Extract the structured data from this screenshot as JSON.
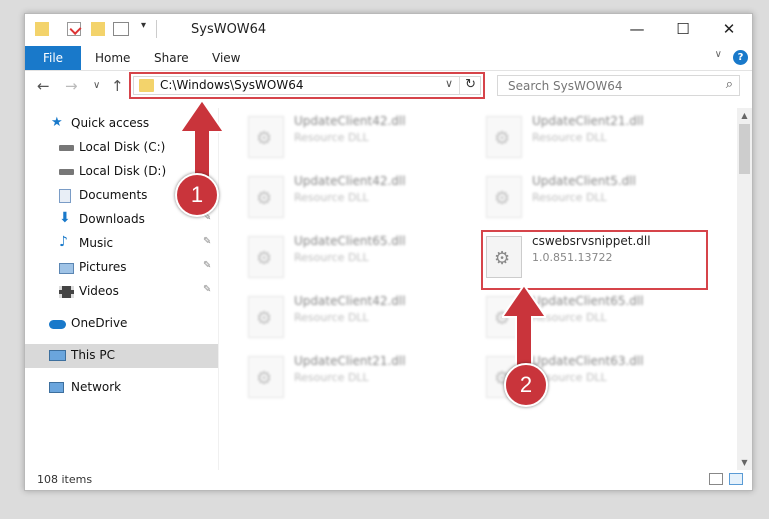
{
  "window": {
    "title": "SysWOW64",
    "controls": {
      "minimize": "—",
      "maximize": "☐",
      "close": "✕"
    }
  },
  "ribbon": {
    "file": "File",
    "tabs": [
      "Home",
      "Share",
      "View"
    ],
    "expand": "∨",
    "help": "?"
  },
  "nav": {
    "back": "←",
    "forward": "→",
    "recent": "∨",
    "up": "↑",
    "address": "C:\\Windows\\SysWOW64",
    "address_dropdown": "∨",
    "refresh": "↻",
    "search_placeholder": "Search SysWOW64",
    "search_icon": "⌕"
  },
  "sidebar": {
    "items": [
      {
        "label": "Quick access",
        "icon": "star-icon",
        "pinned": false
      },
      {
        "label": "Local Disk (C:)",
        "icon": "drive-icon",
        "pinned": true
      },
      {
        "label": "Local Disk (D:)",
        "icon": "drive-icon",
        "pinned": true
      },
      {
        "label": "Documents",
        "icon": "documents-icon",
        "pinned": true
      },
      {
        "label": "Downloads",
        "icon": "downloads-icon",
        "pinned": true
      },
      {
        "label": "Music",
        "icon": "music-icon",
        "pinned": true
      },
      {
        "label": "Pictures",
        "icon": "pictures-icon",
        "pinned": true
      },
      {
        "label": "Videos",
        "icon": "videos-icon",
        "pinned": true
      },
      {
        "label": "OneDrive",
        "icon": "onedrive-icon",
        "pinned": false
      },
      {
        "label": "This PC",
        "icon": "pc-icon",
        "pinned": false,
        "selected": true
      },
      {
        "label": "Network",
        "icon": "network-icon",
        "pinned": false
      }
    ],
    "pin_glyph": "📌"
  },
  "files": [
    {
      "name": "UpdateClient42.dll",
      "sub": "Resource DLL",
      "blurred": true
    },
    {
      "name": "UpdateClient21.dll",
      "sub": "Resource DLL",
      "blurred": true
    },
    {
      "name": "UpdateClient42.dll",
      "sub": "Resource DLL",
      "blurred": true
    },
    {
      "name": "UpdateClient5.dll",
      "sub": "Resource DLL",
      "blurred": true
    },
    {
      "name": "UpdateClient65.dll",
      "sub": "Resource DLL",
      "blurred": true
    },
    {
      "name": "cswebsrvsnippet.dll",
      "sub": "1.0.851.13722",
      "blurred": false
    },
    {
      "name": "UpdateClient42.dll",
      "sub": "Resource DLL",
      "blurred": true
    },
    {
      "name": "UpdateClient65.dll",
      "sub": "Resource DLL",
      "blurred": true
    },
    {
      "name": "UpdateClient21.dll",
      "sub": "Resource DLL",
      "blurred": true
    },
    {
      "name": "UpdateClient63.dll",
      "sub": "Resource DLL",
      "blurred": true
    }
  ],
  "status": {
    "count": "108 items"
  },
  "annotations": {
    "step1": "1",
    "step2": "2"
  },
  "colors": {
    "accent": "#1979ca",
    "highlight": "#d6444a",
    "badge": "#c9343b",
    "folder": "#f3d36b"
  }
}
